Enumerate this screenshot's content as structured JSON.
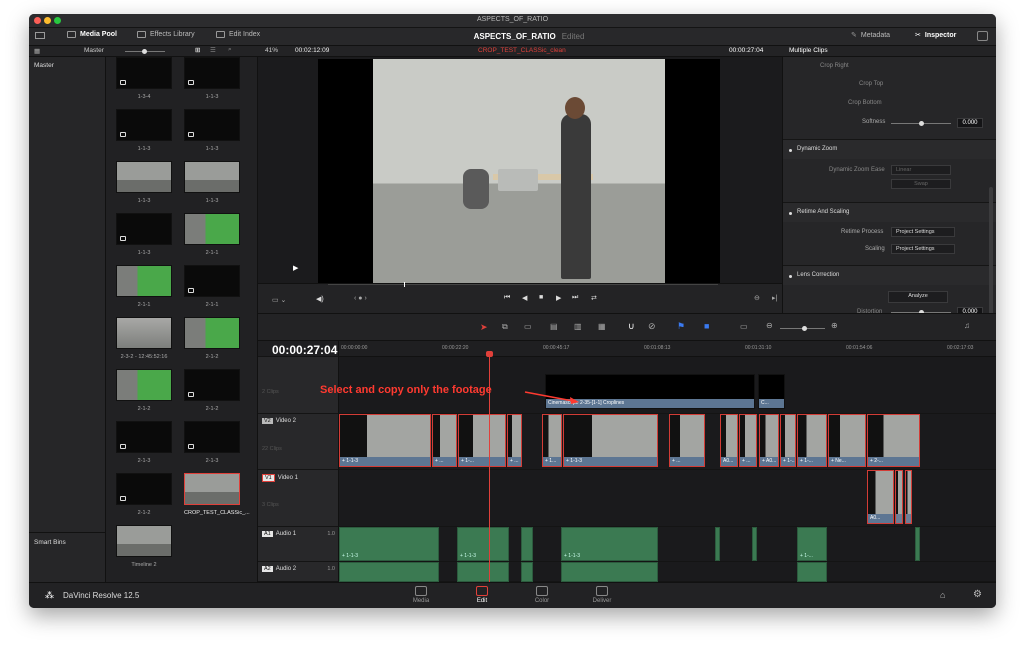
{
  "window": {
    "title": "ASPECTS_OF_RATIO"
  },
  "top_tabs": {
    "media_pool": "Media Pool",
    "effects_library": "Effects Library",
    "edit_index": "Edit Index",
    "metadata": "Metadata",
    "inspector": "Inspector"
  },
  "project": {
    "name": "ASPECTS_OF_RATIO",
    "status": "Edited"
  },
  "toolbar": {
    "bin": "Master",
    "zoom": "41%",
    "source_timecode": "00:02:12:09",
    "clip_name": "CROP_TEST_CLASSic_clean",
    "record_timecode": "00:00:27:04",
    "inspector_title": "Multiple Clips"
  },
  "sidebar": {
    "master": "Master",
    "smart_bins": "Smart Bins"
  },
  "pool_clips": [
    "1-3-4",
    "1-1-3",
    "1-1-3",
    "1-1-3",
    "1-1-3",
    "1-1-3",
    "1-1-3",
    "2-1-1",
    "2-1-1",
    "2-1-1",
    "2-3-2 - 12:45:52:16",
    "2-1-2",
    "2-1-2",
    "2-1-2",
    "2-1-3",
    "2-1-3",
    "2-1-2",
    "CROP_TEST_CLASSic_...",
    "Timeline 2"
  ],
  "inspector": {
    "crop_right": "Crop Right",
    "crop_top": "Crop Top",
    "crop_bottom": "Crop Bottom",
    "softness": "Softness",
    "softness_value": "0.000",
    "dynamic_zoom": "Dynamic Zoom",
    "dynamic_zoom_ease": "Dynamic Zoom Ease",
    "dynamic_zoom_ease_value": "Linear",
    "swap": "Swap",
    "retime_scaling": "Retime And Scaling",
    "retime_process": "Retime Process",
    "retime_process_value": "Project Settings",
    "scaling": "Scaling",
    "scaling_value": "Project Settings",
    "lens_correction": "Lens Correction",
    "analyze": "Analyze",
    "distortion": "Distortion",
    "distortion_value": "0.000"
  },
  "timeline": {
    "timecode": "00:00:27:04",
    "ruler": [
      "00:00:00:00",
      "00:00:22:20",
      "00:00:45:17",
      "00:01:08:13",
      "00:01:31:10",
      "00:01:54:06",
      "00:02:17:03"
    ],
    "tracks": {
      "v3_count": "2 Clips",
      "v2_badge": "V2",
      "v2_name": "Video 2",
      "v2_count": "22 Clips",
      "v1_badge": "V1",
      "v1_name": "Video 1",
      "v1_count": "3 Clips",
      "a1_badge": "A1",
      "a1_name": "Audio 1",
      "a1_ch": "1.0",
      "a2_badge": "A2",
      "a2_name": "Audio 2",
      "a2_ch": "1.0"
    },
    "v3_clip_label": "Cinemascope 2-35-[1-1] Croplines",
    "v3_clip_short": "C...",
    "v2_clip_labels": [
      "+ 1-1-3",
      "+ ...",
      "+ 1-...",
      "+ ...",
      "+ 1...",
      "+ 1-1-3",
      "+ ...",
      "A0...",
      "+ ...",
      "+ A0...",
      "+ 1-...",
      "+ 1-...",
      "+ Ne...",
      "+ 2-..."
    ],
    "v1_clip_label": "A0...",
    "audio_labels": [
      "+ 1-1-3",
      "+ 1-1-3",
      "+ 1-1-3",
      "+ 1-..."
    ]
  },
  "annotation": "Select and copy only the footage",
  "bottom": {
    "app_name": "DaVinci Resolve 12.5",
    "pages": [
      "Media",
      "Edit",
      "Color",
      "Deliver"
    ]
  }
}
